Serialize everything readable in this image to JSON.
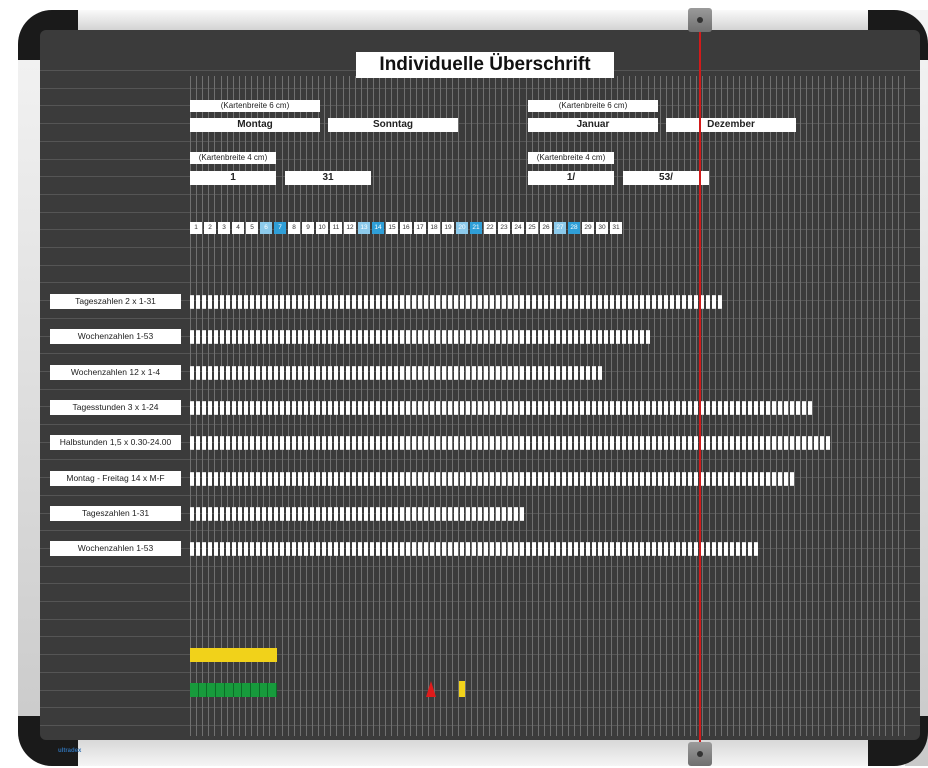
{
  "title": "Individuelle Überschrift",
  "cards_row1": {
    "hint_left": "(Kartenbreite 6 cm)",
    "hint_right": "(Kartenbreite 6 cm)",
    "montag": "Montag",
    "sonntag": "Sonntag",
    "januar": "Januar",
    "dezember": "Dezember"
  },
  "cards_row2": {
    "hint_left": "(Kartenbreite 4 cm)",
    "hint_right": "(Kartenbreite 4 cm)",
    "one": "1",
    "thirtyone": "31",
    "one_slash": "1/",
    "fiftythree": "53/"
  },
  "day_numbers": [
    "1",
    "2",
    "3",
    "4",
    "5",
    "6",
    "7",
    "8",
    "9",
    "10",
    "11",
    "12",
    "13",
    "14",
    "15",
    "16",
    "17",
    "18",
    "19",
    "20",
    "21",
    "22",
    "23",
    "24",
    "25",
    "26",
    "27",
    "28",
    "29",
    "30",
    "31"
  ],
  "row_labels": [
    "Tageszahlen 2 x 1-31",
    "Wochenzahlen 1-53",
    "Wochenzahlen 12 x 1-4",
    "Tagesstunden 3 x 1-24",
    "Halbstunden 1,5 x 0.30-24.00",
    "Montag - Freitag 14 x M-F",
    "Tageszahlen 1-31",
    "Wochenzahlen 1-53"
  ],
  "logo": "ultradex",
  "colors": {
    "board": "#3b3b3b",
    "weekend_light": "#8ccaeb",
    "weekend_dark": "#2f9fd8",
    "yellow": "#f1d21a",
    "green": "#179b3c",
    "red": "#e01b1b"
  }
}
